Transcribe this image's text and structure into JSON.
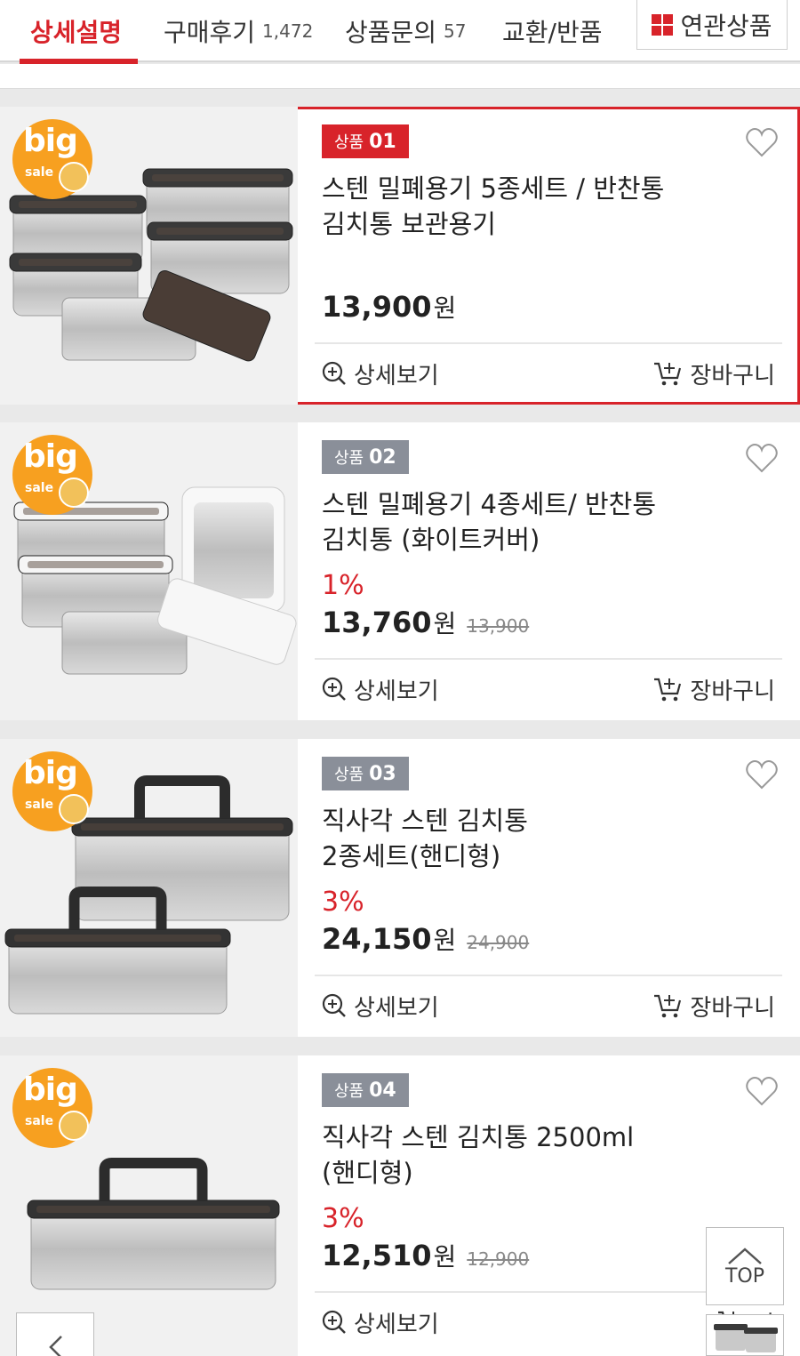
{
  "tabs": [
    {
      "label": "상세설명",
      "count": "",
      "active": true
    },
    {
      "label": "구매후기",
      "count": "1,472",
      "active": false
    },
    {
      "label": "상품문의",
      "count": "57",
      "active": false
    },
    {
      "label": "교환/반품",
      "count": "",
      "active": false
    }
  ],
  "related_tab": {
    "label": "연관상품",
    "icon": "grid-icon"
  },
  "colors": {
    "accent": "#d8232a",
    "badge_gray": "#8a8f99",
    "sticker": "#f7a020"
  },
  "products": [
    {
      "badge_prefix": "상품",
      "badge_number": "01",
      "title_line1": "스텐 밀폐용기 5종세트 / 반찬통",
      "title_line2": "김치통 보관용기",
      "discount": "",
      "price": "13,900",
      "currency": "원",
      "original_price": "",
      "detail_label": "상세보기",
      "cart_label": "장바구니",
      "sticker_text": "big",
      "sticker_sub": "sale"
    },
    {
      "badge_prefix": "상품",
      "badge_number": "02",
      "title_line1": "스텐 밀폐용기 4종세트/ 반찬통",
      "title_line2": "김치통 (화이트커버)",
      "discount": "1%",
      "price": "13,760",
      "currency": "원",
      "original_price": "13,900",
      "detail_label": "상세보기",
      "cart_label": "장바구니",
      "sticker_text": "big",
      "sticker_sub": "sale"
    },
    {
      "badge_prefix": "상품",
      "badge_number": "03",
      "title_line1": "직사각 스텐 김치통",
      "title_line2": "2종세트(핸디형)",
      "discount": "3%",
      "price": "24,150",
      "currency": "원",
      "original_price": "24,900",
      "detail_label": "상세보기",
      "cart_label": "장바구니",
      "sticker_text": "big",
      "sticker_sub": "sale"
    },
    {
      "badge_prefix": "상품",
      "badge_number": "04",
      "title_line1": "직사각 스텐 김치통 2500ml",
      "title_line2": "(핸디형)",
      "discount": "3%",
      "price": "12,510",
      "currency": "원",
      "original_price": "12,900",
      "detail_label": "상세보기",
      "cart_label": "장",
      "sticker_text": "big",
      "sticker_sub": "sale"
    }
  ],
  "floating": {
    "top_label": "TOP"
  }
}
